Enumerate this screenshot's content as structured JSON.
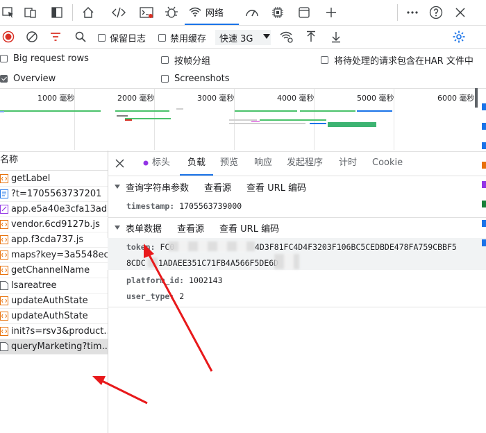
{
  "top_tabs": {
    "network_label": "网络"
  },
  "toolbar": {
    "preserve_log": "保留日志",
    "disable_cache": "禁用缓存",
    "throttle": "快速 3G"
  },
  "options": {
    "big_rows": "Big request rows",
    "group_by_frame": "按帧分组",
    "include_pending_har": "将待处理的请求包含在HAR 文件中",
    "overview": "Overview",
    "screenshots": "Screenshots"
  },
  "overview": {
    "ticks": [
      "1000 毫秒",
      "2000 毫秒",
      "3000 毫秒",
      "4000 毫秒",
      "5000 毫秒",
      "6000 毫秒"
    ]
  },
  "list": {
    "header": "名称",
    "items": [
      "getLabel",
      "?t=1705563737201",
      "app.e5a40e3cfa13ad...",
      "vendor.6cd9127b.js",
      "app.f3cda737.js",
      "maps?key=3a5548ec...",
      "getChannelName",
      "lsareatree",
      "updateAuthState",
      "updateAuthState",
      "init?s=rsv3&product...",
      "queryMarketing?tim..."
    ]
  },
  "detail": {
    "tabs": [
      "标头",
      "负载",
      "预览",
      "响应",
      "发起程序",
      "计时",
      "Cookie"
    ],
    "query_section": {
      "title": "查询字符串参数",
      "view_source": "查看源",
      "view_url_encoded": "查看 URL 编码"
    },
    "query_params": {
      "timestamp_key": "timestamp:",
      "timestamp_val": "1705563739000"
    },
    "form_section": {
      "title": "表单数据",
      "view_source": "查看源",
      "view_url_encoded": "查看 URL 编码"
    },
    "form_params": {
      "token_key": "token:",
      "token_val_start": "FC0",
      "token_val_mid": "4D3F81FC4D4F3203F106BC5CEDBDE478FA759CBBF5",
      "token_val_line2a": "8CDC",
      "token_val_line2b": "1ADAEE351C71FB4A566F5DE6D",
      "platform_key": "platform_id:",
      "platform_val": "1002143",
      "user_type_key": "user_type:",
      "user_type_val": "2"
    }
  },
  "colors": {
    "accent": "#1a73e8",
    "record_red": "#d93025",
    "annotation_red": "#e8191b",
    "purple_dot": "#9334e6"
  }
}
